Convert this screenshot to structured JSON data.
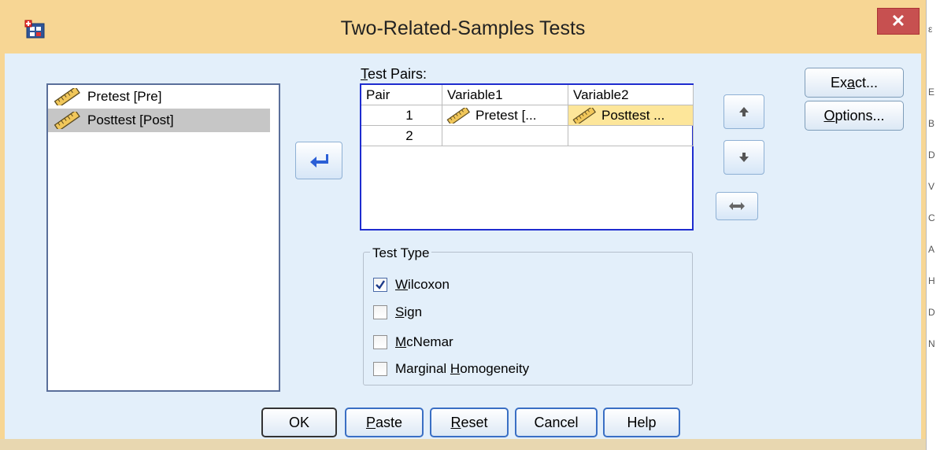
{
  "window": {
    "title": "Two-Related-Samples Tests",
    "close_glyph": "✕"
  },
  "variables": [
    {
      "label": "Pretest [Pre]",
      "selected": false
    },
    {
      "label": "Posttest [Post]",
      "selected": true
    }
  ],
  "test_pairs": {
    "label": "Test Pairs:",
    "columns": [
      "Pair",
      "Variable1",
      "Variable2"
    ],
    "rows": [
      {
        "pair": "1",
        "variable1": "Pretest [...",
        "variable2": "Posttest ..."
      },
      {
        "pair": "2",
        "variable1": "",
        "variable2": ""
      }
    ]
  },
  "side_buttons": {
    "exact": "Exact...",
    "options": "Options..."
  },
  "test_type": {
    "legend": "Test Type",
    "options": [
      {
        "label": "Wilcoxon",
        "checked": true
      },
      {
        "label": "Sign",
        "checked": false
      },
      {
        "label": "McNemar",
        "checked": false
      },
      {
        "label": "Marginal Homogeneity",
        "checked": false
      }
    ]
  },
  "footer_buttons": {
    "ok": "OK",
    "paste": "Paste",
    "reset": "Reset",
    "cancel": "Cancel",
    "help": "Help"
  },
  "edge_text": [
    "ε",
    "E",
    "B",
    "D",
    "V",
    "C",
    "A",
    "H",
    "D",
    "N"
  ],
  "colors": {
    "title_bar": "#f7d694",
    "client": "#e3effa",
    "grid_border": "#1e2ccf",
    "highlight_cell": "#fde69a",
    "close_button": "#c75050"
  }
}
